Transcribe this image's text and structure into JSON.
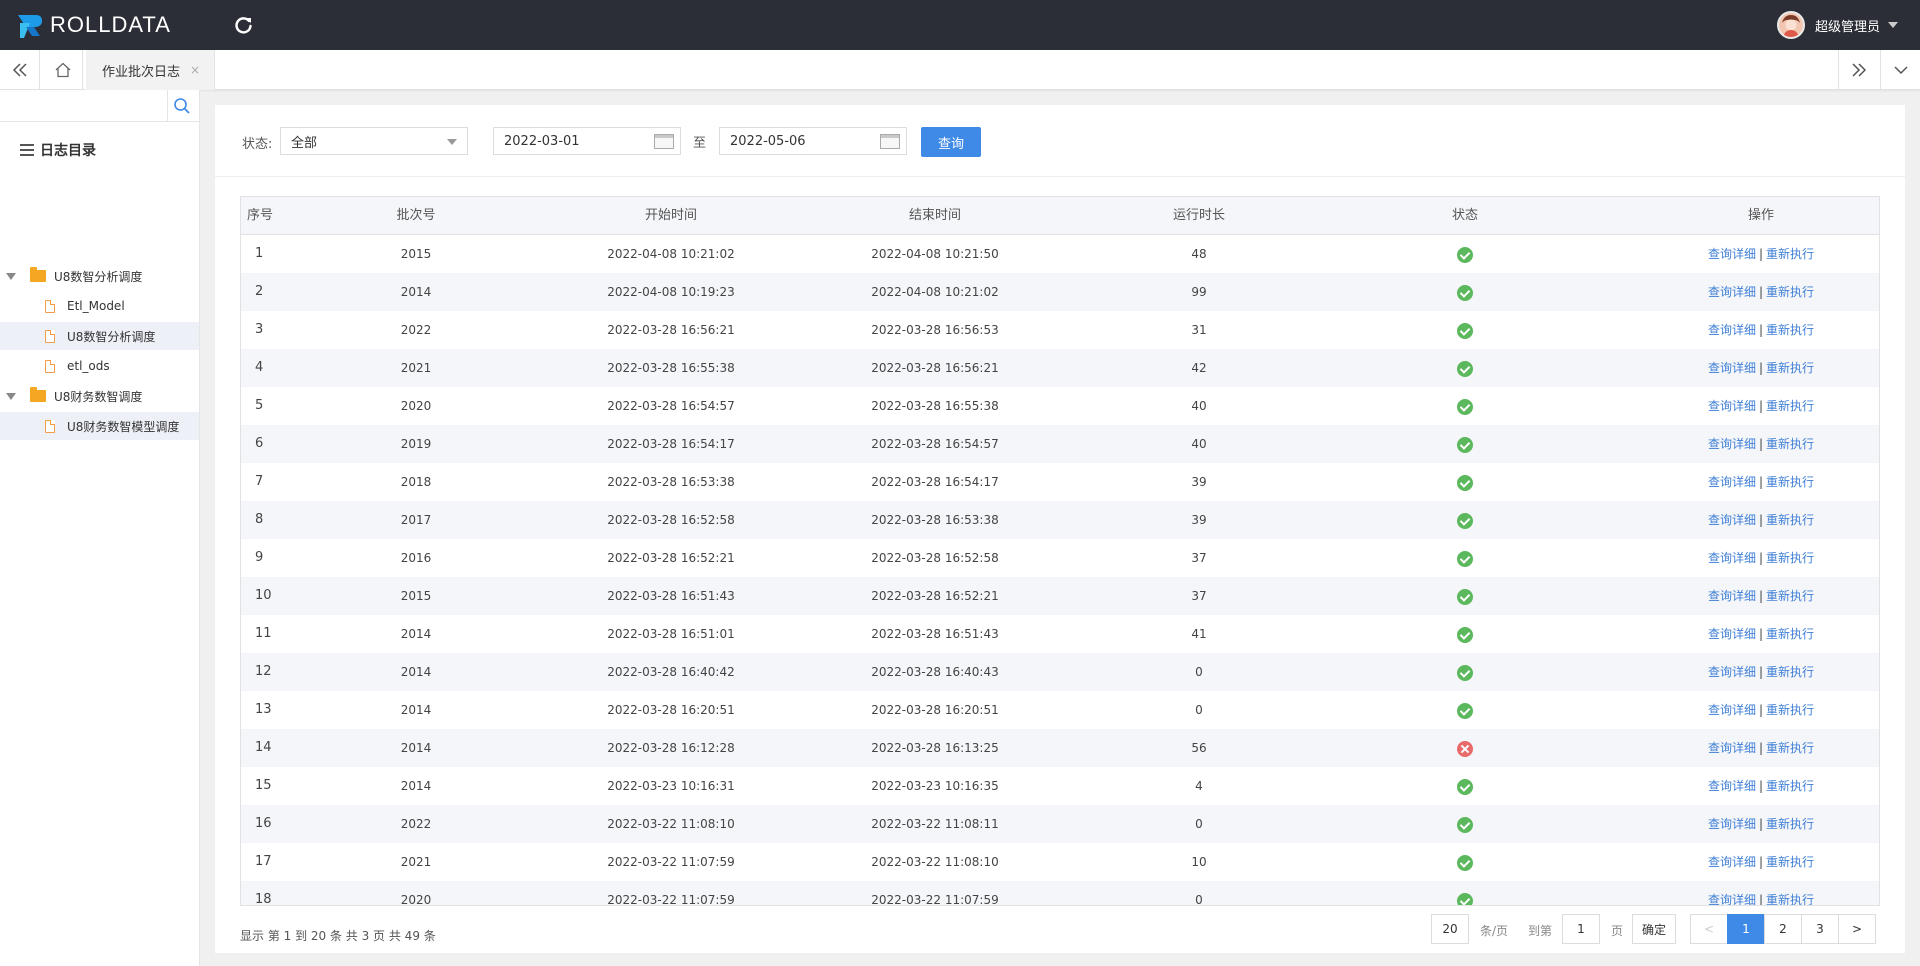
{
  "app": {
    "name": "ROLLDATA",
    "user_name": "超级管理员"
  },
  "tabs": [
    {
      "label": "作业批次日志",
      "close": "×"
    }
  ],
  "sidebar": {
    "search_placeholder": "",
    "title": "日志目录",
    "groups": [
      {
        "label": "U8数智分析调度",
        "items": [
          "Etl_Model",
          "U8数智分析调度",
          "etl_ods"
        ]
      },
      {
        "label": "U8财务数智调度",
        "items": [
          "U8财务数智模型调度"
        ]
      }
    ]
  },
  "filter": {
    "status_label": "状态:",
    "status_value": "全部",
    "start_date": "2022-03-01",
    "to_label": "至",
    "end_date": "2022-05-06",
    "query_button": "查询"
  },
  "table": {
    "columns": [
      "序号",
      "批次号",
      "开始时间",
      "结束时间",
      "运行时长",
      "状态",
      "操作"
    ],
    "action_detail": "查询详细",
    "action_sep": "|",
    "action_rerun": "重新执行",
    "rows": [
      {
        "idx": "1",
        "batch": "2015",
        "start": "2022-04-08 10:21:02",
        "end": "2022-04-08 10:21:50",
        "duration": "48",
        "status": "success"
      },
      {
        "idx": "2",
        "batch": "2014",
        "start": "2022-04-08 10:19:23",
        "end": "2022-04-08 10:21:02",
        "duration": "99",
        "status": "success"
      },
      {
        "idx": "3",
        "batch": "2022",
        "start": "2022-03-28 16:56:21",
        "end": "2022-03-28 16:56:53",
        "duration": "31",
        "status": "success"
      },
      {
        "idx": "4",
        "batch": "2021",
        "start": "2022-03-28 16:55:38",
        "end": "2022-03-28 16:56:21",
        "duration": "42",
        "status": "success"
      },
      {
        "idx": "5",
        "batch": "2020",
        "start": "2022-03-28 16:54:57",
        "end": "2022-03-28 16:55:38",
        "duration": "40",
        "status": "success"
      },
      {
        "idx": "6",
        "batch": "2019",
        "start": "2022-03-28 16:54:17",
        "end": "2022-03-28 16:54:57",
        "duration": "40",
        "status": "success"
      },
      {
        "idx": "7",
        "batch": "2018",
        "start": "2022-03-28 16:53:38",
        "end": "2022-03-28 16:54:17",
        "duration": "39",
        "status": "success"
      },
      {
        "idx": "8",
        "batch": "2017",
        "start": "2022-03-28 16:52:58",
        "end": "2022-03-28 16:53:38",
        "duration": "39",
        "status": "success"
      },
      {
        "idx": "9",
        "batch": "2016",
        "start": "2022-03-28 16:52:21",
        "end": "2022-03-28 16:52:58",
        "duration": "37",
        "status": "success"
      },
      {
        "idx": "10",
        "batch": "2015",
        "start": "2022-03-28 16:51:43",
        "end": "2022-03-28 16:52:21",
        "duration": "37",
        "status": "success"
      },
      {
        "idx": "11",
        "batch": "2014",
        "start": "2022-03-28 16:51:01",
        "end": "2022-03-28 16:51:43",
        "duration": "41",
        "status": "success"
      },
      {
        "idx": "12",
        "batch": "2014",
        "start": "2022-03-28 16:40:42",
        "end": "2022-03-28 16:40:43",
        "duration": "0",
        "status": "success"
      },
      {
        "idx": "13",
        "batch": "2014",
        "start": "2022-03-28 16:20:51",
        "end": "2022-03-28 16:20:51",
        "duration": "0",
        "status": "success"
      },
      {
        "idx": "14",
        "batch": "2014",
        "start": "2022-03-28 16:12:28",
        "end": "2022-03-28 16:13:25",
        "duration": "56",
        "status": "failed"
      },
      {
        "idx": "15",
        "batch": "2014",
        "start": "2022-03-23 10:16:31",
        "end": "2022-03-23 10:16:35",
        "duration": "4",
        "status": "success"
      },
      {
        "idx": "16",
        "batch": "2022",
        "start": "2022-03-22 11:08:10",
        "end": "2022-03-22 11:08:11",
        "duration": "0",
        "status": "success"
      },
      {
        "idx": "17",
        "batch": "2021",
        "start": "2022-03-22 11:07:59",
        "end": "2022-03-22 11:08:10",
        "duration": "10",
        "status": "success"
      },
      {
        "idx": "18",
        "batch": "2020",
        "start": "2022-03-22 11:07:59",
        "end": "2022-03-22 11:07:59",
        "duration": "0",
        "status": "success"
      }
    ]
  },
  "pagination": {
    "info": "显示 第 1 到 20 条 共 3 页 共 49 条",
    "page_size": "20",
    "per_page_label": "条/页",
    "goto_label": "到第",
    "goto_value": "1",
    "page_unit": "页",
    "confirm": "确定",
    "prev": "<",
    "next": ">",
    "pages": [
      "1",
      "2",
      "3"
    ],
    "current_page": "1"
  },
  "colors": {
    "topbar": "#2b2e36",
    "accent": "#3f8ae6",
    "success": "#5cb85c",
    "failed": "#e86a6a",
    "link": "#3f7fd6"
  },
  "icons": {
    "refresh": "refresh-icon",
    "collapse": "double-chevron-left-icon",
    "home": "home-icon",
    "expand": "double-chevron-right-icon",
    "more": "chevron-down-icon",
    "search": "search-icon",
    "calendar": "calendar-icon",
    "folder": "folder-icon",
    "file": "file-icon",
    "menu": "menu-icon"
  }
}
